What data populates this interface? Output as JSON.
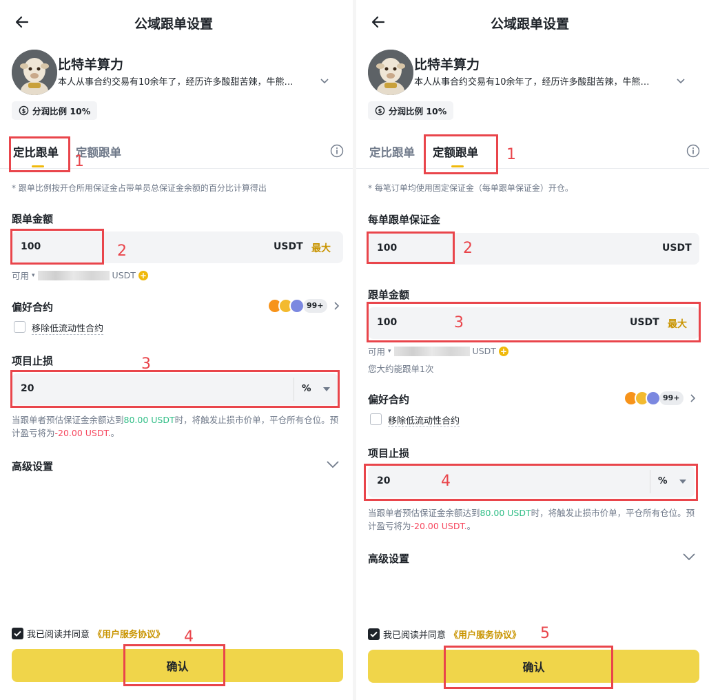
{
  "left": {
    "title": "公域跟单设置",
    "trader_name": "比特羊算力",
    "trader_desc": "本人从事合约交易有10余年了，经历许多酸甜苦辣，牛熊…",
    "share_ratio": "分润比例 10%",
    "tabs": [
      "定比跟单",
      "定额跟单"
    ],
    "note": "* 跟单比例按开仓所用保证金占带单员总保证金余额的百分比计算得出",
    "amount_label": "跟单金额",
    "amount_value": "100",
    "unit": "USDT",
    "max": "最大",
    "avail_label": "可用",
    "avail_unit": "USDT",
    "preferred_label": "偏好合约",
    "more_count": "99+",
    "remove_low_liq": "移除低流动性合约",
    "stoploss_label": "项目止损",
    "stoploss_value": "20",
    "stoploss_unit": "%",
    "warn_prefix": "当跟单者预估保证金余额达到",
    "warn_green": "80.00 USDT",
    "warn_mid": "时，将触发止损市价单，平仓所有仓位。预计盈亏将为",
    "warn_red": "-20.00 USDT.",
    "warn_suffix": "。",
    "advanced": "高级设置",
    "agree_text": "我已阅读并同意",
    "agree_link": "《用户服务协议》",
    "confirm": "确认"
  },
  "right": {
    "title": "公域跟单设置",
    "trader_name": "比特羊算力",
    "trader_desc": "本人从事合约交易有10余年了，经历许多酸甜苦辣，牛熊…",
    "share_ratio": "分润比例 10%",
    "tabs": [
      "定比跟单",
      "定额跟单"
    ],
    "note": "* 每笔订单均使用固定保证金（每单跟单保证金）开仓。",
    "margin_label": "每单跟单保证金",
    "margin_value": "100",
    "amount_label": "跟单金额",
    "amount_value": "100",
    "unit": "USDT",
    "max": "最大",
    "avail_label": "可用",
    "avail_unit": "USDT",
    "times_hint": "您大约能跟单1次",
    "preferred_label": "偏好合约",
    "more_count": "99+",
    "remove_low_liq": "移除低流动性合约",
    "stoploss_label": "项目止损",
    "stoploss_value": "20",
    "stoploss_unit": "%",
    "warn_prefix": "当跟单者预估保证金余额达到",
    "warn_green": "80.00 USDT",
    "warn_mid": "时，将触发止损市价单，平仓所有仓位。预计盈亏将为",
    "warn_red": "-20.00 USDT.",
    "warn_suffix": "。",
    "advanced": "高级设置",
    "agree_text": "我已阅读并同意",
    "agree_link": "《用户服务协议》",
    "confirm": "确认"
  },
  "annotations": {
    "left": [
      "1",
      "2",
      "3",
      "4"
    ],
    "right": [
      "1",
      "2",
      "3",
      "4",
      "5"
    ]
  },
  "colors": {
    "accent": "#f0b90b",
    "confirm_bg": "#f0d54a",
    "annotation": "#e9454b",
    "green": "#2ebd85",
    "red": "#f6465d"
  }
}
